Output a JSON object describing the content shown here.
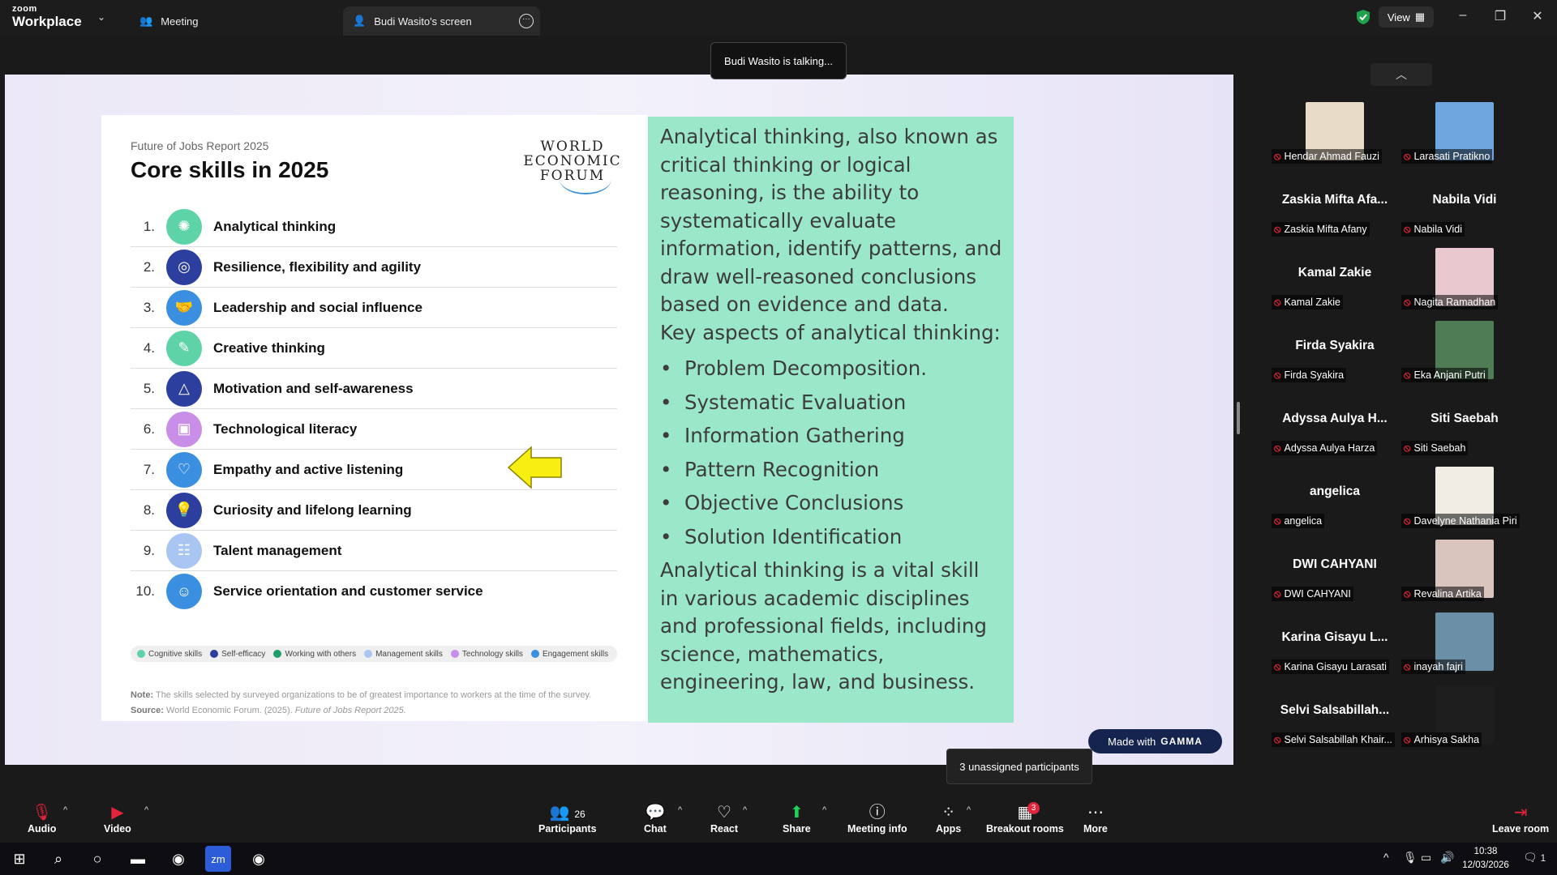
{
  "app": {
    "brand_top": "zoom",
    "brand_bottom": "Workplace"
  },
  "titlebar": {
    "meeting_tab": "Meeting",
    "screen_tab": "Budi Wasito's screen",
    "view_label": "View"
  },
  "talking": "Budi Wasito is talking...",
  "slide": {
    "report": "Future of Jobs Report 2025",
    "title": "Core skills in 2025",
    "wef_line1": "WORLD",
    "wef_line2": "ECONOMIC",
    "wef_line3": "FORUM",
    "skills": [
      {
        "num": "1.",
        "label": "Analytical thinking",
        "color": "#5fd3a8"
      },
      {
        "num": "2.",
        "label": "Resilience, flexibility and agility",
        "color": "#2c3e9e"
      },
      {
        "num": "3.",
        "label": "Leadership and social influence",
        "color": "#3a8fe0"
      },
      {
        "num": "4.",
        "label": "Creative thinking",
        "color": "#5fd3a8"
      },
      {
        "num": "5.",
        "label": "Motivation and self-awareness",
        "color": "#2c3e9e"
      },
      {
        "num": "6.",
        "label": "Technological literacy",
        "color": "#c98ee8"
      },
      {
        "num": "7.",
        "label": "Empathy and active listening",
        "color": "#3a8fe0"
      },
      {
        "num": "8.",
        "label": "Curiosity and lifelong learning",
        "color": "#2c3e9e"
      },
      {
        "num": "9.",
        "label": "Talent management",
        "color": "#a9c6f2"
      },
      {
        "num": "10.",
        "label": "Service orientation and customer service",
        "color": "#3a8fe0"
      }
    ],
    "legend": [
      {
        "label": "Cognitive skills",
        "color": "#5fd3a8"
      },
      {
        "label": "Self-efficacy",
        "color": "#2c3e9e"
      },
      {
        "label": "Working with others",
        "color": "#1f9e6a"
      },
      {
        "label": "Management skills",
        "color": "#a9c6f2"
      },
      {
        "label": "Technology skills",
        "color": "#c98ee8"
      },
      {
        "label": "Engagement skills",
        "color": "#3a8fe0"
      }
    ],
    "note_label": "Note:",
    "note_text": "The skills selected by surveyed organizations to be of greatest importance to workers at the time of the survey.",
    "source_label": "Source:",
    "source_text": "World Economic Forum. (2025).",
    "source_title": "Future of Jobs Report 2025."
  },
  "right_panel": {
    "intro": "Analytical thinking, also known as critical thinking or logical reasoning, is the ability to systematically evaluate information, identify patterns, and draw well-reasoned conclusions based on evidence and data.",
    "key_heading": "Key aspects of analytical thinking:",
    "aspects": [
      "Problem Decomposition.",
      "Systematic Evaluation",
      "Information Gathering",
      "Pattern Recognition",
      "Objective Conclusions",
      "Solution Identification"
    ],
    "closing": "Analytical thinking is a vital skill in various academic disciplines and professional fields, including science, mathematics, engineering, law, and business."
  },
  "gamma": {
    "prefix": "Made with",
    "brand": "GAMMA"
  },
  "participants": [
    {
      "caption": "Hendar Ahmad Fauzi",
      "big": "",
      "thumb": "#e8dcc8"
    },
    {
      "caption": "Larasati Pratikno",
      "big": "",
      "thumb": "#6fa6e0"
    },
    {
      "caption": "Zaskia Mifta Afany",
      "big": "Zaskia Mifta Afa...",
      "thumb": ""
    },
    {
      "caption": "Nabila Vidi",
      "big": "Nabila Vidi",
      "thumb": ""
    },
    {
      "caption": "Kamal Zakie",
      "big": "Kamal Zakie",
      "thumb": ""
    },
    {
      "caption": "Nagita Ramadhan",
      "big": "",
      "thumb": "#e9c9cf"
    },
    {
      "caption": "Firda Syakira",
      "big": "Firda Syakira",
      "thumb": ""
    },
    {
      "caption": "Eka Anjani Putri",
      "big": "",
      "thumb": "#4f7b55"
    },
    {
      "caption": "Adyssa Aulya Harza",
      "big": "Adyssa Aulya H...",
      "thumb": ""
    },
    {
      "caption": "Siti Saebah",
      "big": "Siti Saebah",
      "thumb": ""
    },
    {
      "caption": "angelica",
      "big": "angelica",
      "thumb": ""
    },
    {
      "caption": "Davelyne Nathania Piri",
      "big": "",
      "thumb": "#f2ede4"
    },
    {
      "caption": "DWI CAHYANI",
      "big": "DWI CAHYANI",
      "thumb": ""
    },
    {
      "caption": "Revalina Artika",
      "big": "",
      "thumb": "#d9c4be"
    },
    {
      "caption": "Karina Gisayu Larasati",
      "big": "Karina Gisayu L...",
      "thumb": ""
    },
    {
      "caption": "inayah fajri",
      "big": "",
      "thumb": "#6a8fa6"
    },
    {
      "caption": "Selvi Salsabillah Khair...",
      "big": "Selvi  Salsabillah...",
      "thumb": ""
    },
    {
      "caption": "Arhisya Sakha",
      "big": "",
      "thumb": "#1e1e1e"
    }
  ],
  "unassigned": "3 unassigned participants",
  "toolbar": {
    "audio": "Audio",
    "video": "Video",
    "participants": "Participants",
    "participants_count": "26",
    "chat": "Chat",
    "react": "React",
    "share": "Share",
    "meeting_info": "Meeting info",
    "apps": "Apps",
    "breakout": "Breakout rooms",
    "breakout_badge": "3",
    "more": "More",
    "leave": "Leave room"
  },
  "taskbar": {
    "time": "10:38",
    "date": "12/03/2026",
    "notif_count": "1"
  }
}
